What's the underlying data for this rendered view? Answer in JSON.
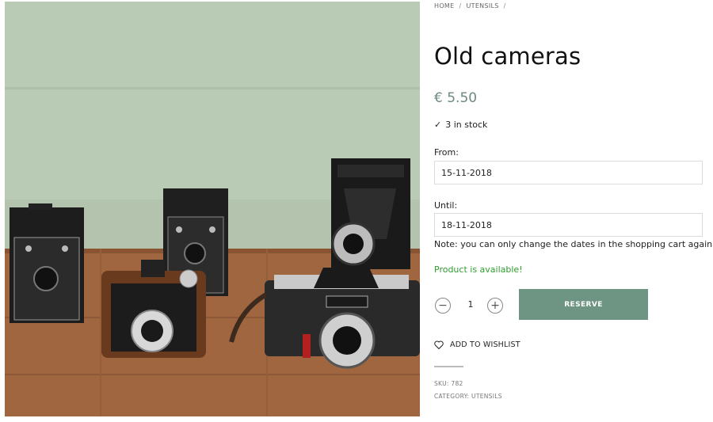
{
  "breadcrumb": {
    "home": "HOME",
    "sep1": "/",
    "category": "UTENSILS",
    "sep2": "/"
  },
  "product": {
    "title": "Old cameras",
    "price": "€ 5.50",
    "stock_icon": "✓",
    "stock": "3 in stock",
    "image_alt": "Collection of vintage box and folding cameras on a wooden table"
  },
  "booking": {
    "from_label": "From:",
    "from_value": "15-11-2018",
    "until_label": "Until:",
    "until_value": "18-11-2018",
    "note": "Note: you can only change the dates in the shopping cart again!",
    "availability": "Product is available!"
  },
  "quantity": {
    "minus": "−",
    "value": "1",
    "plus": "+"
  },
  "actions": {
    "reserve": "RESERVE",
    "wishlist": "ADD TO WISHLIST"
  },
  "meta": {
    "sku": "SKU: 782",
    "category": "CATEGORY: UTENSILS"
  },
  "colors": {
    "accent": "#6e9484",
    "price": "#6a8a7e",
    "available": "#2f9e2f"
  }
}
